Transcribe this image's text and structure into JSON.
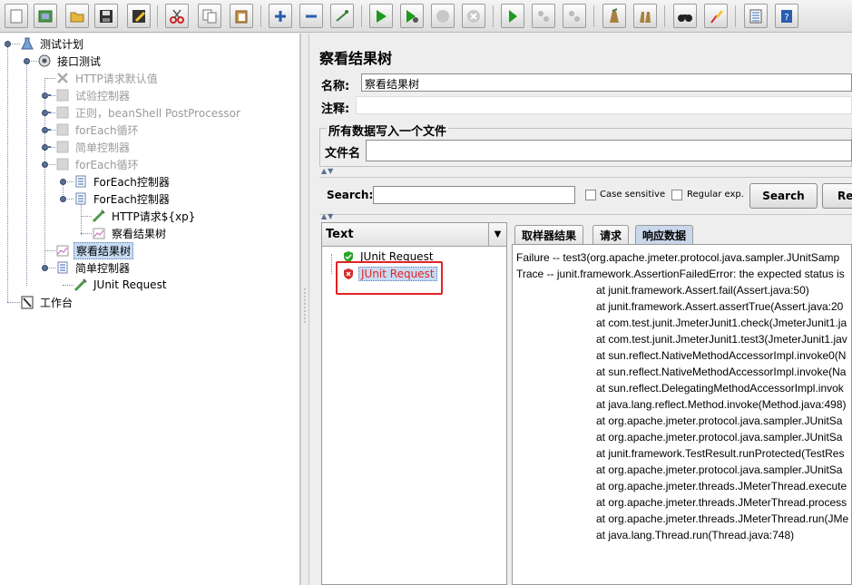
{
  "toolbar": {
    "buttons": [
      "new-icon",
      "templates-icon",
      "open-icon",
      "save-icon",
      "save-as-icon",
      "cut-icon",
      "copy-icon",
      "paste-icon",
      "expand-icon",
      "collapse-icon",
      "toggle-icon",
      "start-icon",
      "start-no-pause-icon",
      "stop-icon",
      "shutdown-icon",
      "remote-start-icon",
      "remote-stop-icon",
      "remote-exit-icon",
      "clear-icon",
      "clear-all-icon",
      "search-icon",
      "reset-search-icon",
      "function-helper-icon",
      "help-icon"
    ]
  },
  "tree": {
    "nodes": [
      {
        "label": "测试计划",
        "icon": "test-plan-icon"
      },
      {
        "label": "接口测试",
        "icon": "thread-group-icon"
      },
      {
        "label": "HTTP请求默认值",
        "icon": "config-icon"
      },
      {
        "label": "试验控制器",
        "icon": "controller-icon"
      },
      {
        "label": "正则，beanShell PostProcessor",
        "icon": "controller-icon"
      },
      {
        "label": "forEach循环",
        "icon": "controller-icon"
      },
      {
        "label": "简单控制器",
        "icon": "controller-icon"
      },
      {
        "label": "forEach循环",
        "icon": "controller-icon"
      },
      {
        "label": "ForEach控制器",
        "icon": "foreach-icon"
      },
      {
        "label": "ForEach控制器",
        "icon": "foreach-icon"
      },
      {
        "label": "HTTP请求${xp}",
        "icon": "sampler-icon"
      },
      {
        "label": "察看结果树",
        "icon": "listener-icon"
      },
      {
        "label": "察看结果树",
        "icon": "listener-icon"
      },
      {
        "label": "简单控制器",
        "icon": "controller-icon"
      },
      {
        "label": "JUnit Request",
        "icon": "sampler-icon"
      },
      {
        "label": "工作台",
        "icon": "workbench-icon"
      }
    ]
  },
  "panel": {
    "title": "察看结果树",
    "name_label": "名称:",
    "name_value": "察看结果树",
    "comment_label": "注释:",
    "comment_value": "",
    "file_section_title": "所有数据写入一个文件",
    "file_label": "文件名",
    "file_value": ""
  },
  "search": {
    "label": "Search:",
    "value": "",
    "case_sensitive": "Case sensitive",
    "regular_exp": "Regular exp.",
    "search_button": "Search",
    "reset_button": "Re"
  },
  "results": {
    "column_header": "Text",
    "items": [
      {
        "label": "JUnit Request",
        "status": "success"
      },
      {
        "label": "JUnit Request",
        "status": "failure"
      }
    ]
  },
  "tabs": [
    "取样器结果",
    "请求",
    "响应数据"
  ],
  "response": {
    "lines": [
      "Failure -- test3(org.apache.jmeter.protocol.java.sampler.JUnitSamp",
      "Trace -- junit.framework.AssertionFailedError: the expected status is",
      "at junit.framework.Assert.fail(Assert.java:50)",
      "at junit.framework.Assert.assertTrue(Assert.java:20",
      "at com.test.junit.JmeterJunit1.check(JmeterJunit1.ja",
      "at com.test.junit.JmeterJunit1.test3(JmeterJunit1.jav",
      "at sun.reflect.NativeMethodAccessorImpl.invoke0(N",
      "at sun.reflect.NativeMethodAccessorImpl.invoke(Na",
      "at sun.reflect.DelegatingMethodAccessorImpl.invok",
      "at java.lang.reflect.Method.invoke(Method.java:498)",
      "at org.apache.jmeter.protocol.java.sampler.JUnitSa",
      "at org.apache.jmeter.protocol.java.sampler.JUnitSa",
      "at junit.framework.TestResult.runProtected(TestRes",
      "at org.apache.jmeter.protocol.java.sampler.JUnitSa",
      "at org.apache.jmeter.threads.JMeterThread.execute",
      "at org.apache.jmeter.threads.JMeterThread.process",
      "at org.apache.jmeter.threads.JMeterThread.run(JMe",
      "at java.lang.Thread.run(Thread.java:748)"
    ]
  },
  "colors": {
    "accent": "#c7dbf3",
    "failure": "#e52222",
    "success": "#2aa52a"
  }
}
